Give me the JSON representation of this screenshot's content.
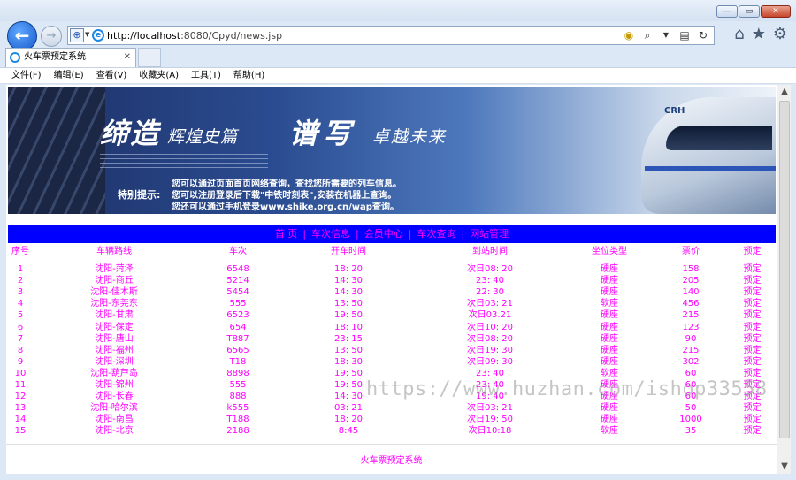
{
  "browser": {
    "url_host": "http://localhost",
    "url_rest": ":8080/Cpyd/news.jsp",
    "tab_title": "火车票预定系统",
    "menu": [
      "文件(F)",
      "编辑(E)",
      "查看(V)",
      "收藏夹(A)",
      "工具(T)",
      "帮助(H)"
    ]
  },
  "banner": {
    "slogan_a": "缔造",
    "slogan_a_small": "辉煌史篇",
    "slogan_b": "谱写",
    "slogan_b_small": "卓越未来",
    "train_logo": "CRH",
    "note_label": "特别提示:",
    "note_lines": [
      "您可以通过页面首页网络查询，查找您所需要的列车信息。",
      "您可以注册登录后下载\"中铁时刻表\",安装在机器上查询。",
      "您还可以通过手机登录www.shike.org.cn/wap查询。"
    ]
  },
  "nav": [
    "首 页",
    "车次信息",
    "会员中心",
    "车次查询",
    "网站管理"
  ],
  "table": {
    "headers": [
      "序号",
      "车辆路线",
      "车次",
      "开车时间",
      "到站时间",
      "坐位类型",
      "票价",
      "预定"
    ],
    "rows": [
      [
        "1",
        "沈阳-菏泽",
        "6548",
        "18: 20",
        "次日08: 20",
        "硬座",
        "158",
        "预定"
      ],
      [
        "2",
        "沈阳-商丘",
        "5214",
        "14: 30",
        "23: 40",
        "硬座",
        "205",
        "预定"
      ],
      [
        "3",
        "沈阳-佳木斯",
        "5454",
        "14: 30",
        "22: 30",
        "硬座",
        "140",
        "预定"
      ],
      [
        "4",
        "沈阳-东莞东",
        "555",
        "13: 50",
        "次日03: 21",
        "软座",
        "456",
        "预定"
      ],
      [
        "5",
        "沈阳-甘肃",
        "6523",
        "19: 50",
        "次日03.21",
        "硬座",
        "215",
        "预定"
      ],
      [
        "6",
        "沈阳-保定",
        "654",
        "18: 10",
        "次日10: 20",
        "硬座",
        "123",
        "预定"
      ],
      [
        "7",
        "沈阳-唐山",
        "T887",
        "23: 15",
        "次日08: 20",
        "硬座",
        "90",
        "预定"
      ],
      [
        "8",
        "沈阳-福州",
        "6565",
        "13: 50",
        "次日19: 30",
        "硬座",
        "215",
        "预定"
      ],
      [
        "9",
        "沈阳-深圳",
        "T18",
        "18: 30",
        "次日09: 30",
        "硬座",
        "302",
        "预定"
      ],
      [
        "10",
        "沈阳-葫芦岛",
        "8898",
        "19: 50",
        "23: 40",
        "软座",
        "60",
        "预定"
      ],
      [
        "11",
        "沈阳-锦州",
        "555",
        "19: 50",
        "23: 40",
        "硬座",
        "60",
        "预定"
      ],
      [
        "12",
        "沈阳-长春",
        "888",
        "14: 30",
        "19: 40",
        "硬座",
        "60",
        "预定"
      ],
      [
        "13",
        "沈阳-哈尔滨",
        "k555",
        "03: 21",
        "次日03: 21",
        "硬座",
        "50",
        "预定"
      ],
      [
        "14",
        "沈阳-南昌",
        "T188",
        "18: 20",
        "次日19: 50",
        "硬座",
        "1000",
        "预定"
      ],
      [
        "15",
        "沈阳-北京",
        "2188",
        "8:45",
        "次日10:18",
        "软座",
        "35",
        "预定"
      ]
    ]
  },
  "footer": "火车票预定系统",
  "watermark": "https://www.huzhan.com/ishop33558",
  "colors": {
    "nav_bg": "#0000ff",
    "text_accent": "#ff00ff"
  }
}
